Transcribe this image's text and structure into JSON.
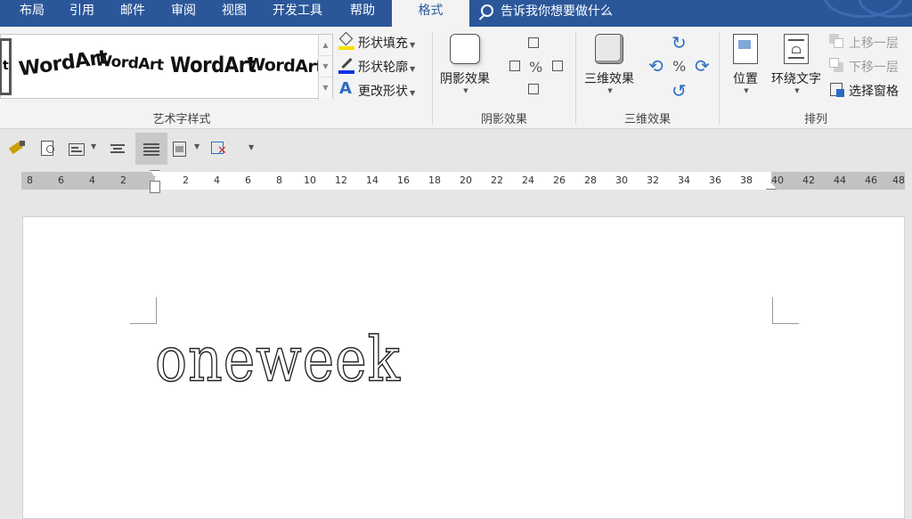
{
  "tabs": [
    {
      "label": "布局"
    },
    {
      "label": "引用"
    },
    {
      "label": "邮件"
    },
    {
      "label": "审阅"
    },
    {
      "label": "视图"
    },
    {
      "label": "开发工具"
    },
    {
      "label": "帮助"
    },
    {
      "label": "格式",
      "active": true
    }
  ],
  "tellme": "告诉我你想要做什么",
  "ribbon": {
    "wordart_styles": {
      "items": [
        "WordArt",
        "WordArt",
        "WordArt",
        "WordArt"
      ],
      "partial": "t",
      "group_label": "艺术字样式",
      "fill": "形状填充",
      "outline": "形状轮廓",
      "change_shape": "更改形状"
    },
    "shadow": {
      "button": "阴影效果",
      "group_label": "阴影效果"
    },
    "threed": {
      "button": "三维效果",
      "group_label": "三维效果"
    },
    "arrange": {
      "position": "位置",
      "wrap": "环绕文字",
      "bring_forward": "上移一层",
      "send_backward": "下移一层",
      "selection_pane": "选择窗格",
      "group_label": "排列"
    }
  },
  "ruler": {
    "left_numbers": [
      "8",
      "6",
      "4",
      "2"
    ],
    "right_numbers": [
      "2",
      "4",
      "6",
      "8",
      "10",
      "12",
      "14",
      "16",
      "18",
      "20",
      "22",
      "24",
      "26",
      "28",
      "30",
      "32",
      "34",
      "36",
      "38",
      "40",
      "42",
      "44",
      "46",
      "48"
    ]
  },
  "document": {
    "wordart_text": "oneweek"
  },
  "colors": {
    "tab_blue": "#2b579a",
    "fill_yellow": "#f5e000",
    "outline_blue": "#1030e0",
    "shape_blue": "#2b6cc4"
  }
}
